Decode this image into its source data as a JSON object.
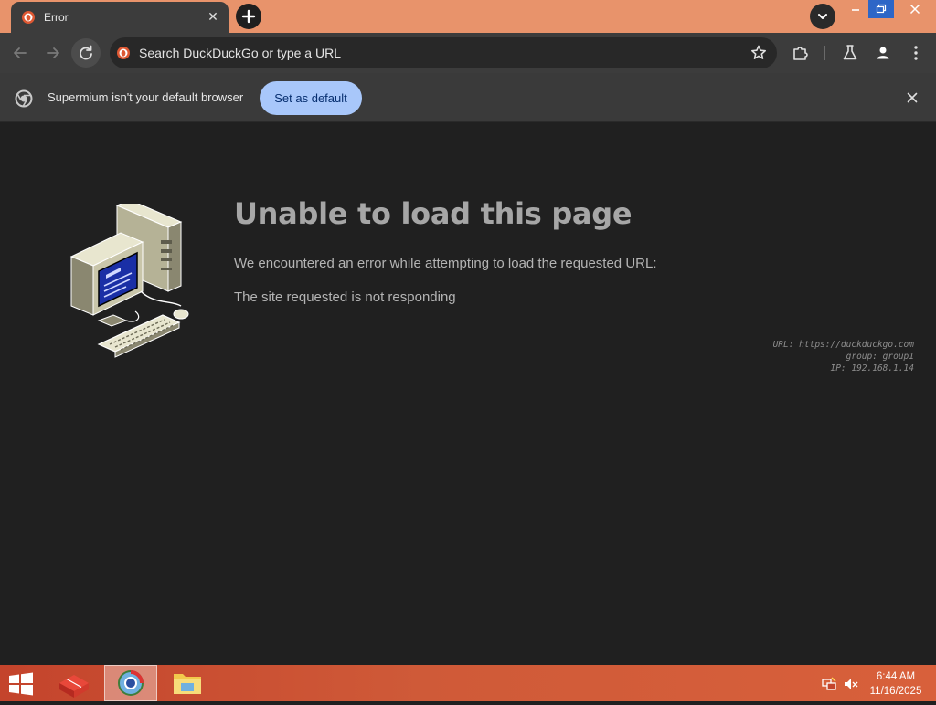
{
  "browser": {
    "tab": {
      "title": "Error",
      "favicon": "duckduckgo-icon"
    },
    "omnibox": {
      "placeholder": "Search DuckDuckGo or type a URL"
    },
    "infobar": {
      "message": "Supermium isn't your default browser",
      "button_label": "Set as default"
    }
  },
  "error_page": {
    "title": "Unable to load this page",
    "description": "We encountered an error while attempting to load the requested URL:",
    "reason": "The site requested is not responding",
    "meta": {
      "url_line": "URL: https://duckduckgo.com",
      "group_line": "group: group1",
      "ip_line": "IP: 192.168.1.14"
    }
  },
  "taskbar": {
    "clock_time": "6:44 AM",
    "clock_date": "11/16/2025",
    "apps": [
      "parcel-app-icon",
      "supermium-browser-icon",
      "file-explorer-icon"
    ]
  },
  "colors": {
    "titlebar": "#e8936b",
    "toolbar": "#3c3c3c",
    "content_bg": "#202020",
    "infobar_button": "#a8c7fa",
    "taskbar": "#cf5a38"
  }
}
